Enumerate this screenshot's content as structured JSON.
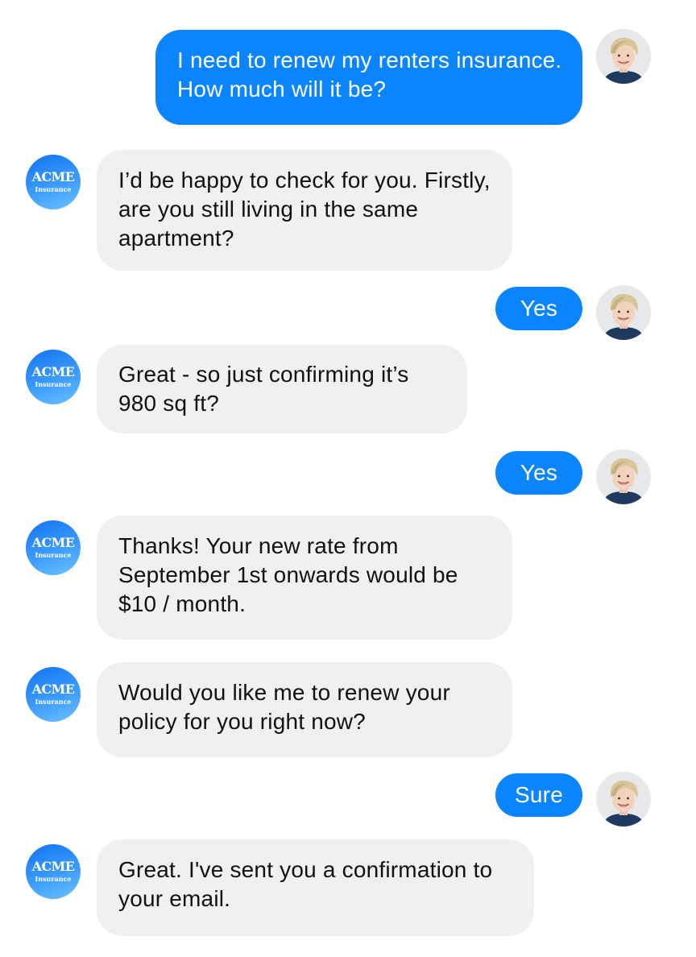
{
  "brand": {
    "name": "ACME",
    "subtitle": "Insurance",
    "colors": {
      "user_bubble": "#0a84ff",
      "bot_bubble": "#f0f0f0",
      "avatar_gradient_start": "#1374ee",
      "avatar_gradient_end": "#6cc2ff"
    }
  },
  "user_avatar": {
    "icon": "user-photo-avatar"
  },
  "messages": [
    {
      "sender": "user",
      "text": "I need to renew my renters insurance. How much will it be?"
    },
    {
      "sender": "bot",
      "text": "I’d be happy to check for you. Firstly, are you still living in the same apartment?"
    },
    {
      "sender": "user",
      "text": "Yes"
    },
    {
      "sender": "bot",
      "text": "Great - so just confirming it’s 980 sq ft?"
    },
    {
      "sender": "user",
      "text": "Yes"
    },
    {
      "sender": "bot",
      "text": "Thanks! Your new rate from September 1st onwards would be $10 / month."
    },
    {
      "sender": "bot",
      "text": "Would you like me to renew your policy for you right now?"
    },
    {
      "sender": "user",
      "text": "Sure"
    },
    {
      "sender": "bot",
      "text": "Great. I've sent you a confirmation to your email."
    }
  ]
}
